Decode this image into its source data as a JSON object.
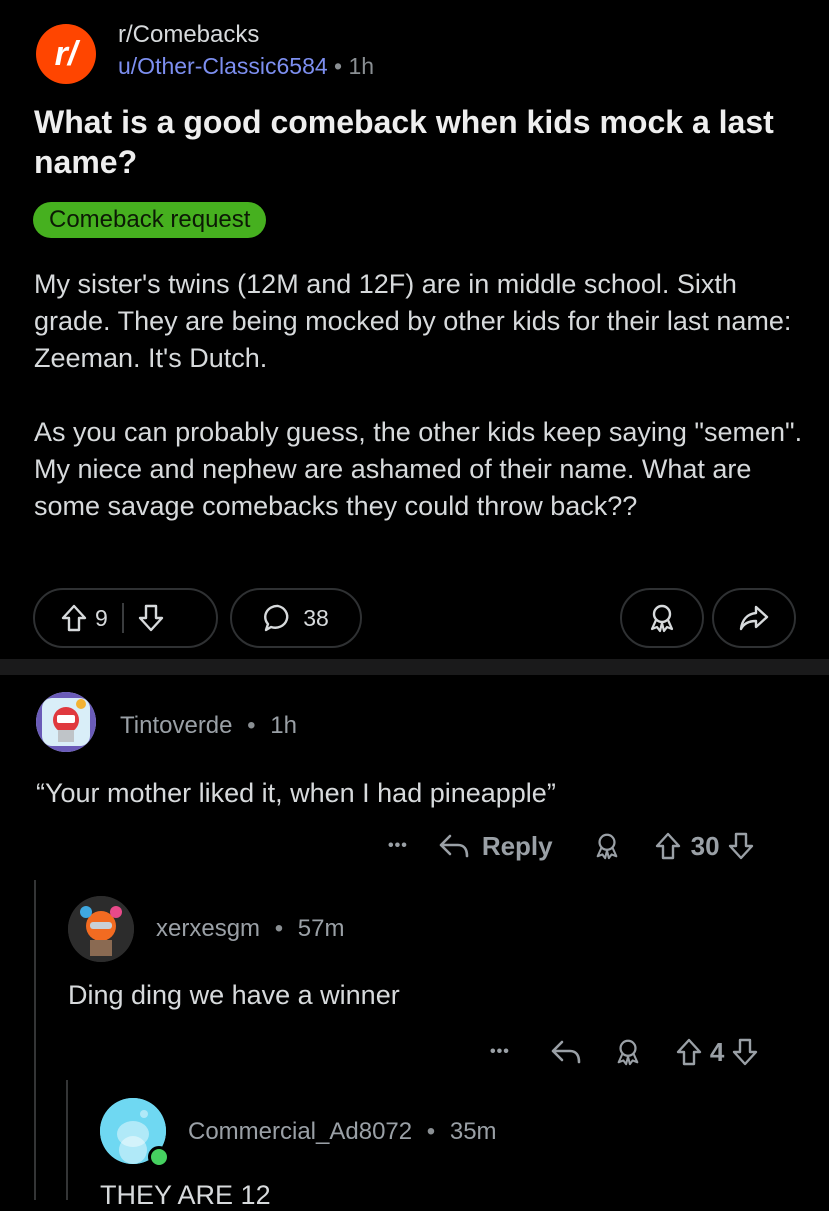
{
  "post": {
    "subreddit_logo": "r/",
    "subreddit": "r/Comebacks",
    "author": "u/Other-Classic6584",
    "separator": "•",
    "age": "1h",
    "title": "What is a good comeback when kids mock a last name?",
    "flair": "Comeback request",
    "body": [
      "My sister's twins (12M and 12F) are in middle school. Sixth grade. They are being mocked by other kids for their last name: Zeeman. It's Dutch.",
      "As you can probably guess, the other kids keep saying \"semen\". My niece and nephew are ashamed of their name.  What are some savage comebacks they could throw back??"
    ],
    "score": "9",
    "comment_count": "38"
  },
  "comments": [
    {
      "user": "Tintoverde",
      "age": "1h",
      "text": "“Your mother liked it, when I had pineapple”",
      "more": "•••",
      "reply_label": "Reply",
      "score": "30"
    },
    {
      "user": "xerxesgm",
      "age": "57m",
      "text": "Ding ding we have a winner",
      "more": "•••",
      "score": "4"
    },
    {
      "user": "Commercial_Ad8072",
      "age": "35m",
      "text": "THEY ARE 12"
    }
  ],
  "icons": {
    "upvote": "upvote-arrow-icon",
    "downvote": "downvote-arrow-icon",
    "comment": "speech-bubble-icon",
    "award": "award-icon",
    "share": "share-arrow-icon",
    "reply": "reply-arrow-icon",
    "more": "more-dots-icon"
  },
  "colors": {
    "background": "#000000",
    "subreddit_orange": "#ff4500",
    "flair_green": "#46b01f",
    "username_blue": "#7d8ff0",
    "online_green": "#46d160"
  }
}
